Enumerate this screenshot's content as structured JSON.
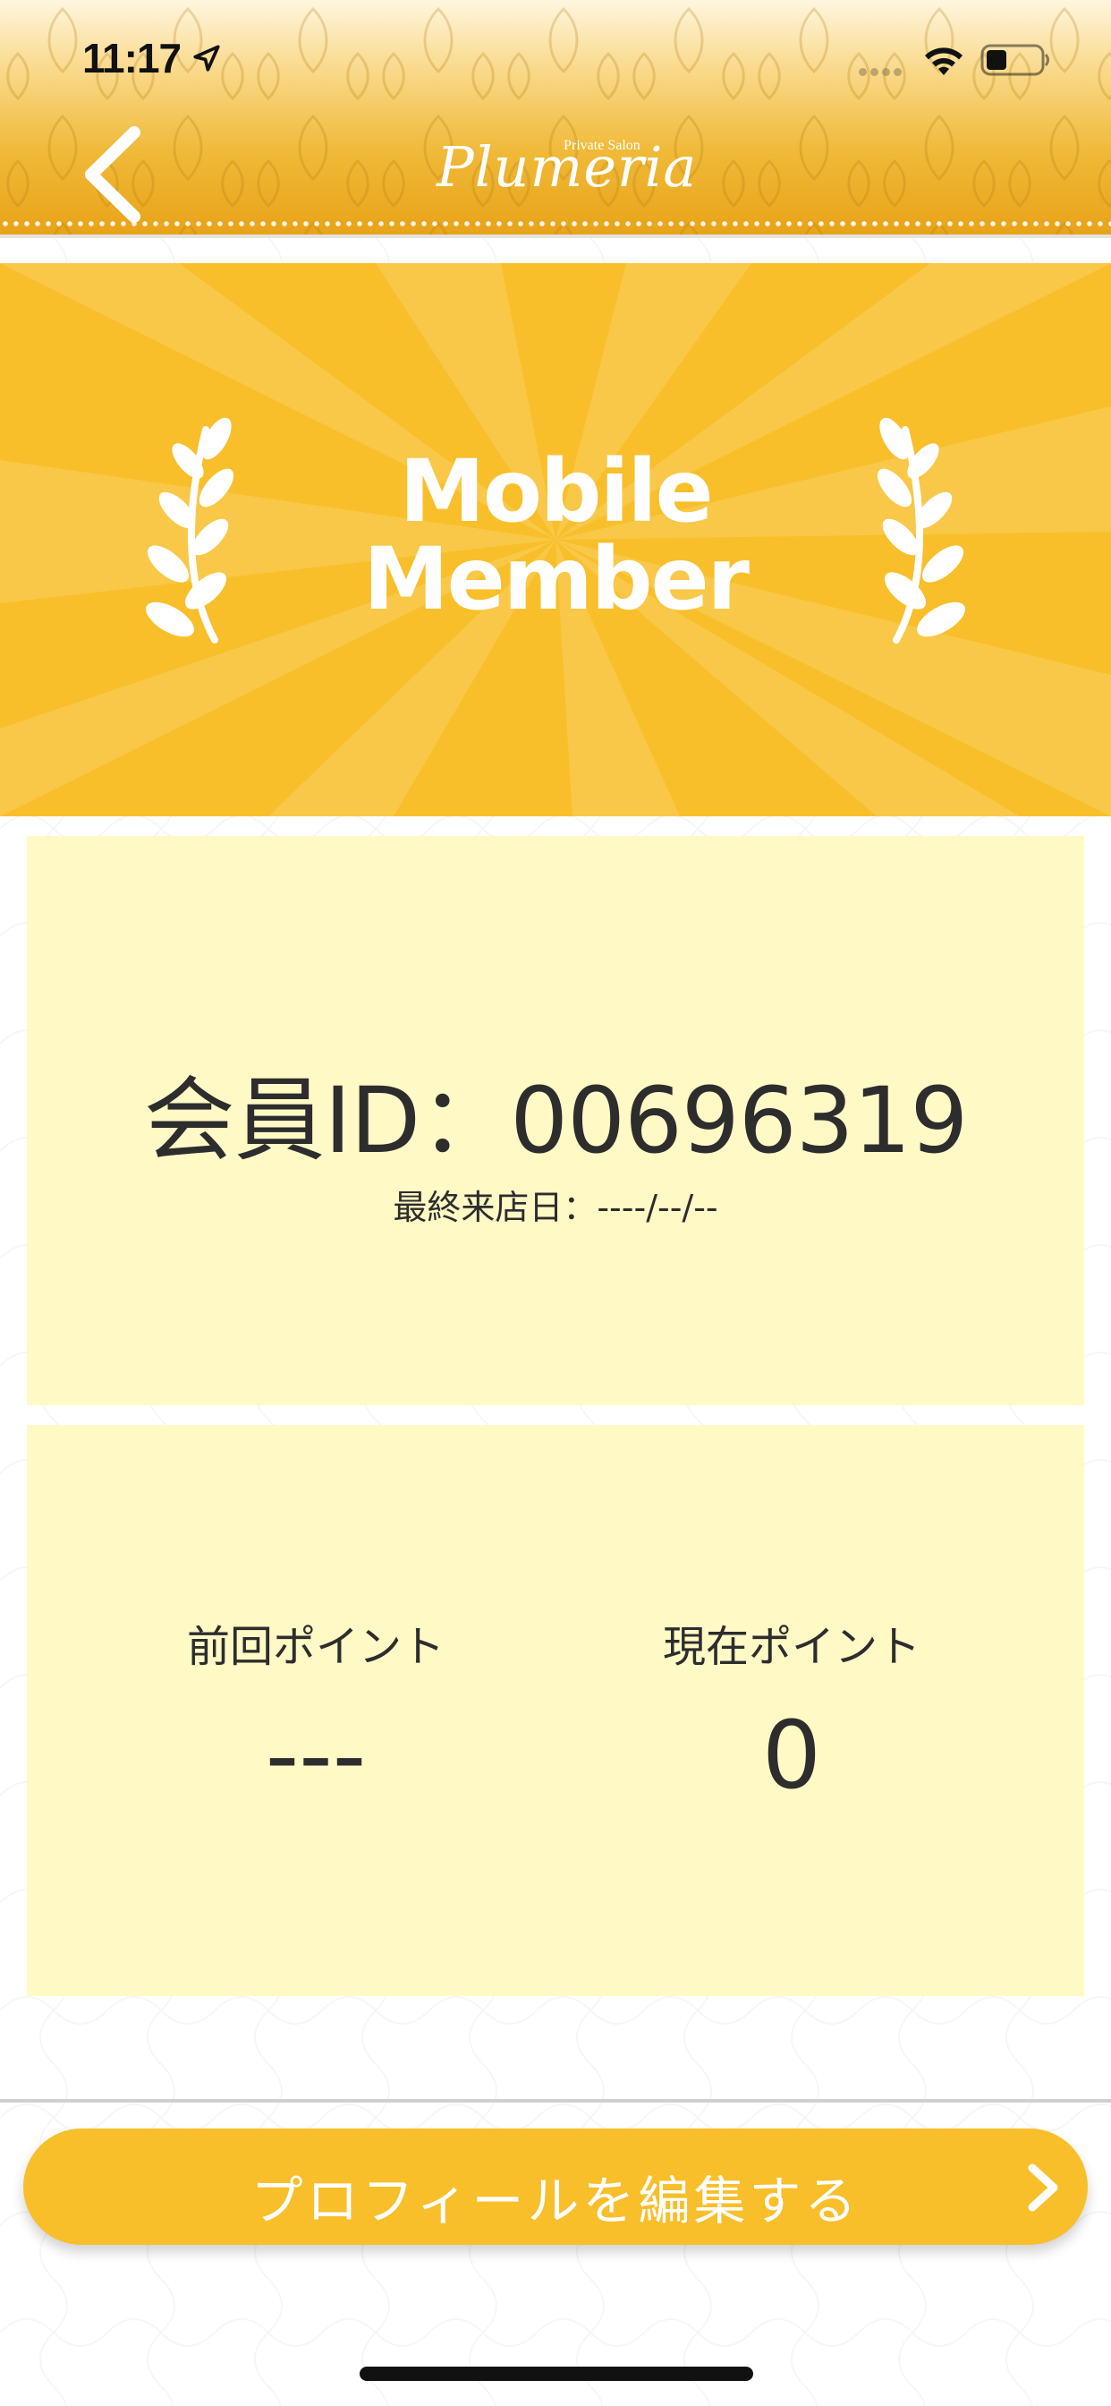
{
  "status_bar": {
    "time": "11:17",
    "location_icon": "location-arrow-icon",
    "signal_icon": "cellular-signal-icon",
    "wifi_icon": "wifi-icon",
    "battery_icon": "battery-icon"
  },
  "header": {
    "back_icon": "chevron-left-icon",
    "logo_small": "Private Salon",
    "logo_main": "Plumeria"
  },
  "banner": {
    "title_line1": "Mobile",
    "title_line2": "Member",
    "laurel_icon": "laurel-icon"
  },
  "member": {
    "id_text": "会員ID：00696319",
    "last_visit_text": "最終来店日：----/--/--"
  },
  "points": {
    "previous_label": "前回ポイント",
    "previous_value": "---",
    "current_label": "現在ポイント",
    "current_value": "0"
  },
  "footer": {
    "edit_profile_label": "プロフィールを編集する",
    "chevron_icon": "chevron-right-icon"
  },
  "colors": {
    "accent": "#f8bf2b",
    "card_bg": "#fff9c6",
    "text": "#2d2d2d"
  }
}
